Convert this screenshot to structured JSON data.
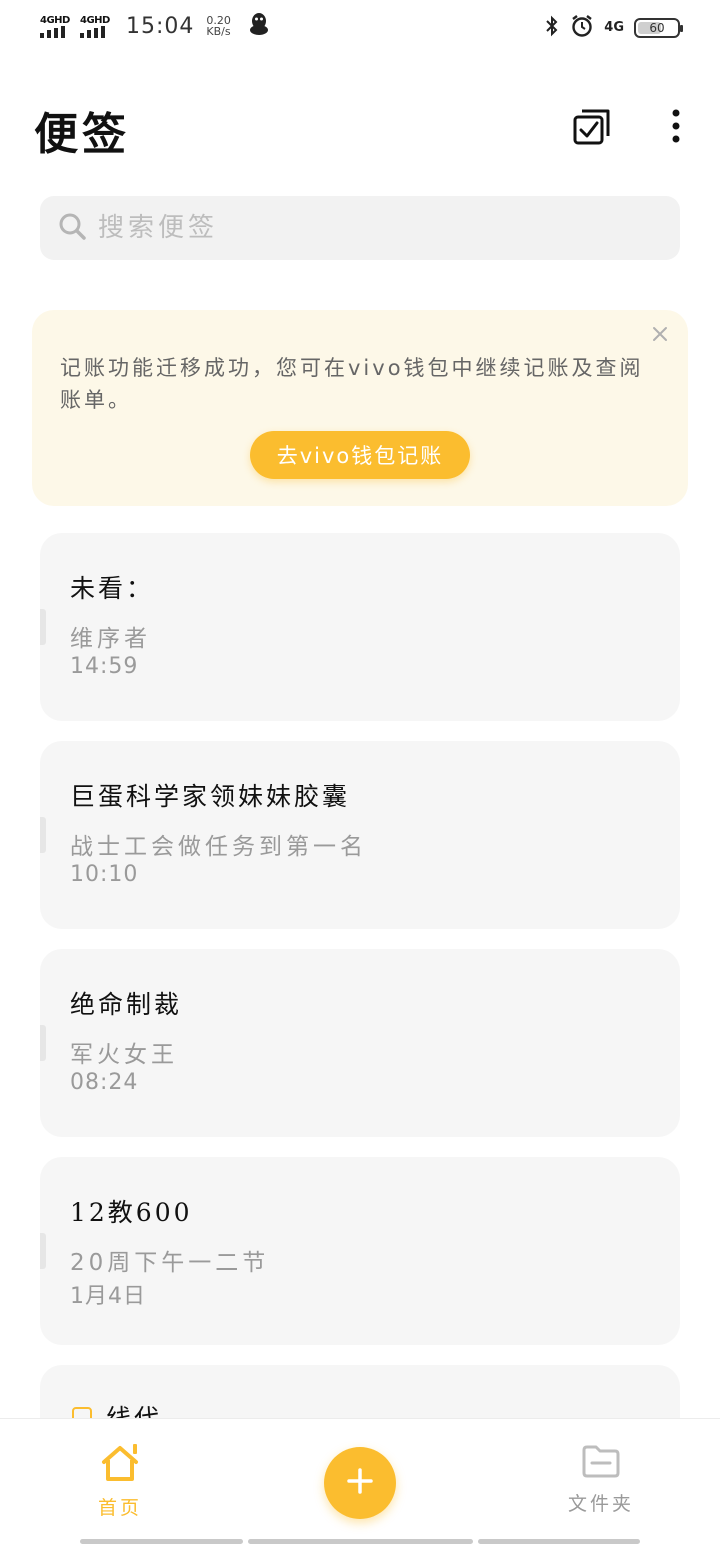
{
  "status_bar": {
    "signal1_label": "4GHD",
    "signal2_label": "4GHD",
    "time": "15:04",
    "speed_value": "0.20",
    "speed_unit": "KB/s",
    "network_label": "4G",
    "battery_level": 60,
    "battery_text": "60"
  },
  "header": {
    "title": "便签"
  },
  "search": {
    "placeholder": "搜索便签"
  },
  "banner": {
    "text": "记账功能迁移成功，您可在vivo钱包中继续记账及查阅账单。",
    "button_label": "去vivo钱包记账"
  },
  "notes": [
    {
      "title": "未看：",
      "subtitle": "维序者",
      "time": "14:59"
    },
    {
      "title": "巨蛋科学家领妹妹胶囊",
      "subtitle": "战士工会做任务到第一名",
      "time": "10:10"
    },
    {
      "title": "绝命制裁",
      "subtitle": "军火女王",
      "time": "08:24"
    },
    {
      "title": "12教600",
      "subtitle": "20周下午一二节",
      "time": "1月4日"
    },
    {
      "title": "线代",
      "subtitle": "",
      "time": ""
    }
  ],
  "bottom_nav": {
    "home_label": "首页",
    "folder_label": "文件夹"
  },
  "colors": {
    "accent": "#fbbd2f",
    "banner_bg": "#fdf8e8",
    "card_bg": "#f6f6f6",
    "muted_text": "#9a9a9a"
  }
}
